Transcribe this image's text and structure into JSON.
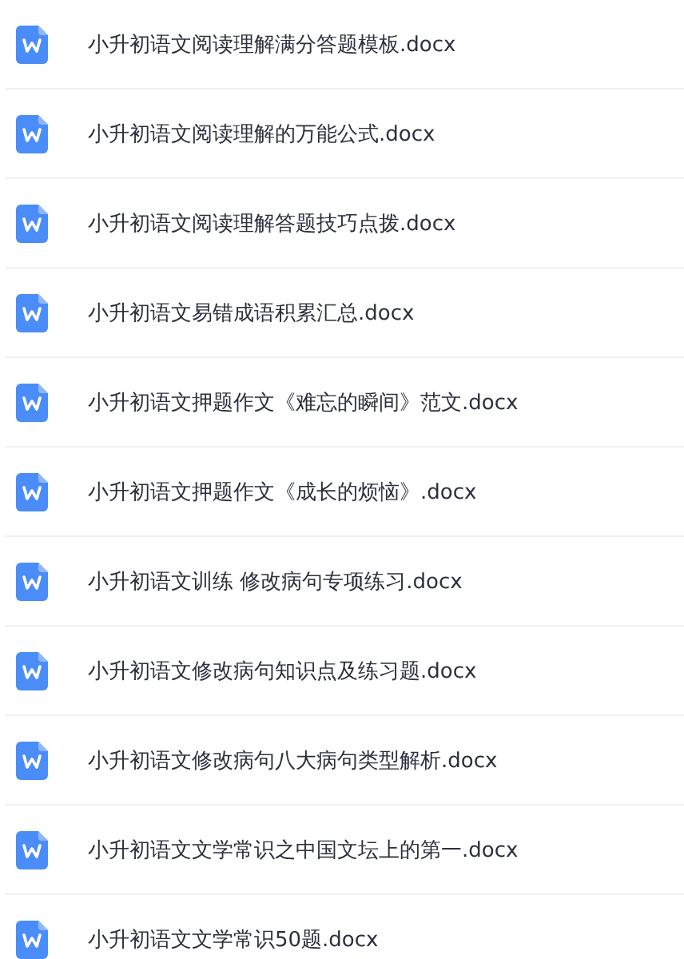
{
  "files": [
    {
      "name": "小升初语文阅读理解满分答题模板.docx"
    },
    {
      "name": "小升初语文阅读理解的万能公式.docx"
    },
    {
      "name": "小升初语文阅读理解答题技巧点拨.docx"
    },
    {
      "name": "小升初语文易错成语积累汇总.docx"
    },
    {
      "name": "小升初语文押题作文《难忘的瞬间》范文.docx"
    },
    {
      "name": "小升初语文押题作文《成长的烦恼》.docx"
    },
    {
      "name": "小升初语文训练 修改病句专项练习.docx"
    },
    {
      "name": "小升初语文修改病句知识点及练习题.docx"
    },
    {
      "name": "小升初语文修改病句八大病句类型解析.docx"
    },
    {
      "name": "小升初语文文学常识之中国文坛上的第一.docx"
    },
    {
      "name": "小升初语文文学常识50题.docx"
    }
  ]
}
